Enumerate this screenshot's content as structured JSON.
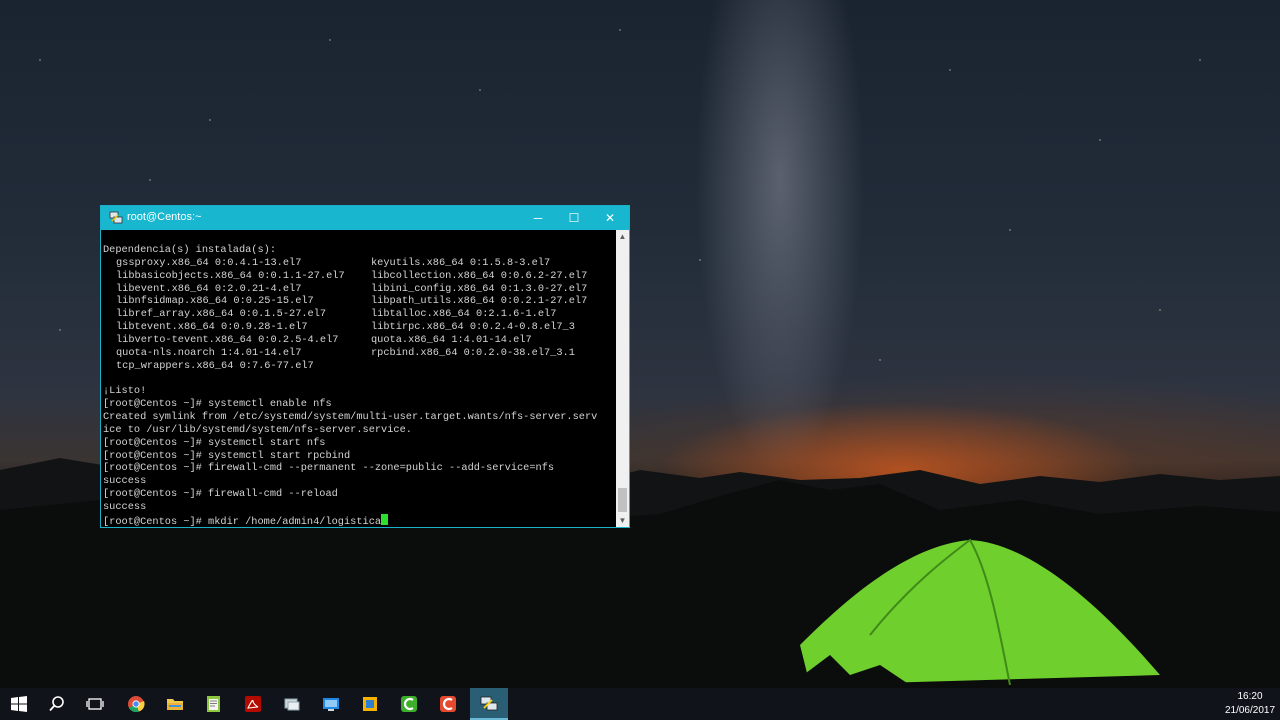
{
  "window": {
    "title": "root@Centos:~",
    "min_label": "─",
    "max_label": "☐",
    "close_label": "✕"
  },
  "terminal": {
    "deps_header": "Dependencia(s) instalada(s):",
    "deps": [
      [
        "gssproxy.x86_64 0:0.4.1-13.el7",
        "keyutils.x86_64 0:1.5.8-3.el7"
      ],
      [
        "libbasicobjects.x86_64 0:0.1.1-27.el7",
        "libcollection.x86_64 0:0.6.2-27.el7"
      ],
      [
        "libevent.x86_64 0:2.0.21-4.el7",
        "libini_config.x86_64 0:1.3.0-27.el7"
      ],
      [
        "libnfsidmap.x86_64 0:0.25-15.el7",
        "libpath_utils.x86_64 0:0.2.1-27.el7"
      ],
      [
        "libref_array.x86_64 0:0.1.5-27.el7",
        "libtalloc.x86_64 0:2.1.6-1.el7"
      ],
      [
        "libtevent.x86_64 0:0.9.28-1.el7",
        "libtirpc.x86_64 0:0.2.4-0.8.el7_3"
      ],
      [
        "libverto-tevent.x86_64 0:0.2.5-4.el7",
        "quota.x86_64 1:4.01-14.el7"
      ],
      [
        "quota-nls.noarch 1:4.01-14.el7",
        "rpcbind.x86_64 0:0.2.0-38.el7_3.1"
      ],
      [
        "tcp_wrappers.x86_64 0:7.6-77.el7",
        ""
      ]
    ],
    "lines": [
      "",
      "¡Listo!",
      "[root@Centos ~]# systemctl enable nfs",
      "Created symlink from /etc/systemd/system/multi-user.target.wants/nfs-server.serv",
      "ice to /usr/lib/systemd/system/nfs-server.service.",
      "[root@Centos ~]# systemctl start nfs",
      "[root@Centos ~]# systemctl start rpcbind",
      "[root@Centos ~]# firewall-cmd --permanent --zone=public --add-service=nfs",
      "success",
      "[root@Centos ~]# firewall-cmd --reload",
      "success"
    ],
    "current_prompt": "[root@Centos ~]# mkdir /home/admin4/logistica"
  },
  "taskbar": {
    "items": [
      "start-icon",
      "search-icon",
      "task-view-icon",
      "chrome-icon",
      "file-explorer-icon",
      "notepad-icon",
      "acrobat-icon",
      "network-icon",
      "remote-desktop-icon",
      "folder-app-icon",
      "camtasia-icon",
      "camtasia-recorder-icon",
      "putty-icon"
    ],
    "time": "16:20",
    "date": "21/06/2017"
  }
}
